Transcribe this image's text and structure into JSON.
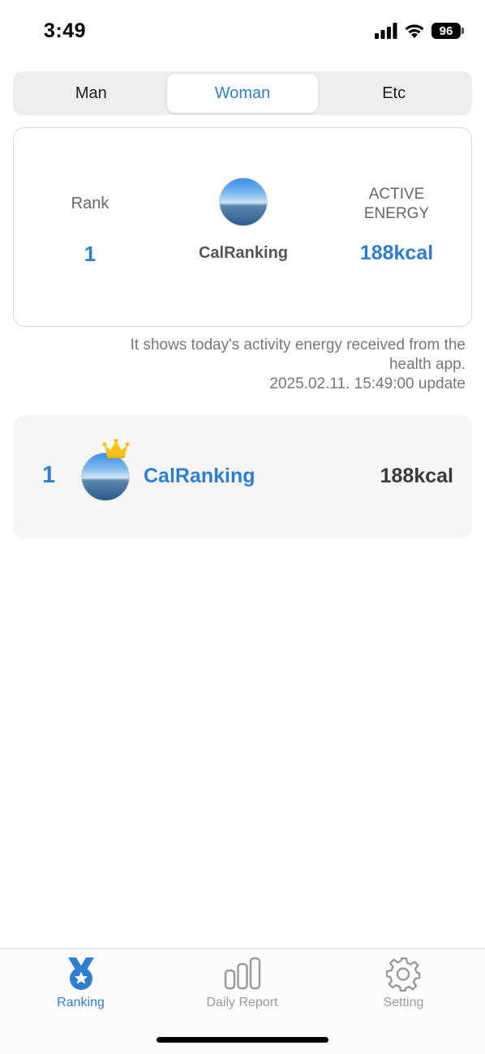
{
  "status_bar": {
    "time": "3:49",
    "battery": "96"
  },
  "segments": [
    {
      "label": "Man",
      "active": false
    },
    {
      "label": "Woman",
      "active": true
    },
    {
      "label": "Etc",
      "active": false
    }
  ],
  "my_card": {
    "rank_label": "Rank",
    "rank_value": "1",
    "user_name": "CalRanking",
    "energy_label_line1": "ACTIVE",
    "energy_label_line2": "ENERGY",
    "energy_value": "188kcal"
  },
  "info": {
    "line1": "It shows today's activity energy received from the",
    "line2": "health app.",
    "line3": "2025.02.11. 15:49:00 update"
  },
  "ranking_list": [
    {
      "rank": "1",
      "name": "CalRanking",
      "value": "188kcal"
    }
  ],
  "tab_bar": {
    "ranking": "Ranking",
    "daily_report": "Daily Report",
    "setting": "Setting"
  },
  "colors": {
    "accent": "#2f7fd0",
    "crown": "#f7c21c"
  }
}
